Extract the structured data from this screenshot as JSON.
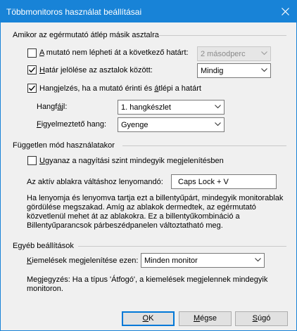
{
  "window": {
    "title": "Többmonitoros használat beállításai"
  },
  "group1": {
    "title": "Amikor az egérmutató átlép másik asztalra",
    "no_cross": {
      "label_pre": "",
      "accel": "A",
      "label_post": " mutató nem lépheti át a következő határt:",
      "checked": false,
      "combo_value": "2 másodperc"
    },
    "border_mark": {
      "label_pre": "",
      "accel": "H",
      "label_post": "atár jelölése az asztalok között:",
      "checked": true,
      "combo_value": "Mindig"
    },
    "sound": {
      "label_pre": "Hangjelzés, ha a mutató érinti és ",
      "accel": "á",
      "label_post": "tlépi a határt",
      "checked": true
    },
    "sound_file": {
      "label_pre": "Hangf",
      "accel": "á",
      "label_post": "jl:",
      "value": "1. hangkészlet"
    },
    "warning_sound": {
      "label_pre": "",
      "accel": "F",
      "label_post": "igyelmeztető hang:",
      "value": "Gyenge"
    }
  },
  "group2": {
    "title": "Független mód használatakor",
    "same_zoom": {
      "label_pre": "",
      "accel": "U",
      "label_post": "gyanaz a nagyítási szint mindegyik megjelenítésben",
      "checked": false
    },
    "hotkey_label": "Az aktív ablakra váltáshoz lenyomandó:",
    "hotkey_value": "Caps Lock + V",
    "description": [
      "Ha lenyomja és lenyomva tartja ezt a billentyűpárt, mindegyik monitorablak",
      "gördülése megszakad. Amíg az ablakok dermedtek, az egérmutató",
      "közvetlenül mehet át az ablakokra. Ez a billentyűkombináció a",
      "Billentyűparancsok párbeszédpanelen változtatható meg."
    ]
  },
  "group3": {
    "title": "Egyéb beállítások",
    "highlight": {
      "label_pre": "",
      "accel": "K",
      "label_post": "iemelések megjelenítése ezen:",
      "value": "Minden monitor"
    },
    "note": [
      "Megjegyzés: Ha a típus 'Átfogó', a kiemelések megjelennek mindegyik",
      "monitoron."
    ]
  },
  "buttons": {
    "ok": {
      "pre": "",
      "accel": "O",
      "post": "K"
    },
    "cancel": {
      "pre": "",
      "accel": "M",
      "post": "égse"
    },
    "help": {
      "pre": "",
      "accel": "S",
      "post": "úgó"
    }
  }
}
